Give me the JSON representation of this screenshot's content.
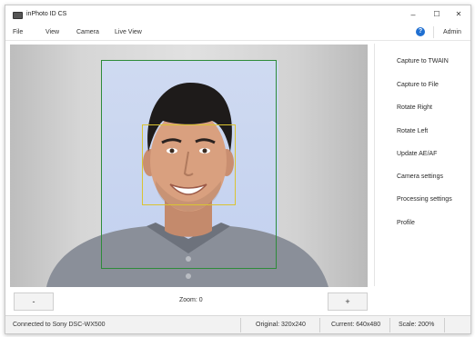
{
  "window": {
    "title": "inPhoto ID CS",
    "minimize": "–",
    "maximize": "☐",
    "close": "✕"
  },
  "menu": {
    "items": [
      "File",
      "View",
      "Camera",
      "Live View"
    ],
    "help": "?",
    "user": "Admin"
  },
  "sidebar": {
    "items": [
      "Capture to TWAIN",
      "Capture to File",
      "Rotate Right",
      "Rotate Left",
      "Update AE/AF",
      "Camera settings",
      "Processing settings",
      "Profile"
    ]
  },
  "zoom_bar": {
    "minus_label": "-",
    "zoom_text": "Zoom: 0",
    "plus_label": "+"
  },
  "status": {
    "connection": "Connected to Sony DSC-WX500",
    "original": "Original: 320x240",
    "current": "Current: 640x480",
    "scale": "Scale: 200%"
  },
  "colors": {
    "accent": "#1f6fd1",
    "crop_frame": "#2e8b3a",
    "face_frame": "#d9c332"
  }
}
